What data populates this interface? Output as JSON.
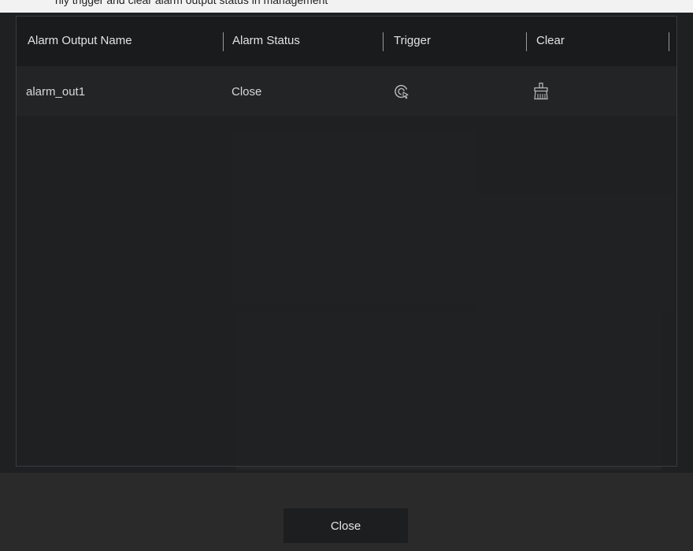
{
  "window": {
    "top_text": "nly trigger and clear alarm output status in management"
  },
  "table": {
    "headers": [
      "Alarm Output Name",
      "Alarm Status",
      "Trigger",
      "Clear"
    ],
    "rows": [
      {
        "name": "alarm_out1",
        "status": "Close",
        "trigger_icon": "trigger-icon",
        "clear_icon": "broom-icon"
      }
    ]
  },
  "footer": {
    "close_label": "Close"
  },
  "colors": {
    "header_bg": "#1a1b1d",
    "row_bg": "#232426",
    "text": "#d8d8d8",
    "button_bg": "#1d1e20"
  }
}
